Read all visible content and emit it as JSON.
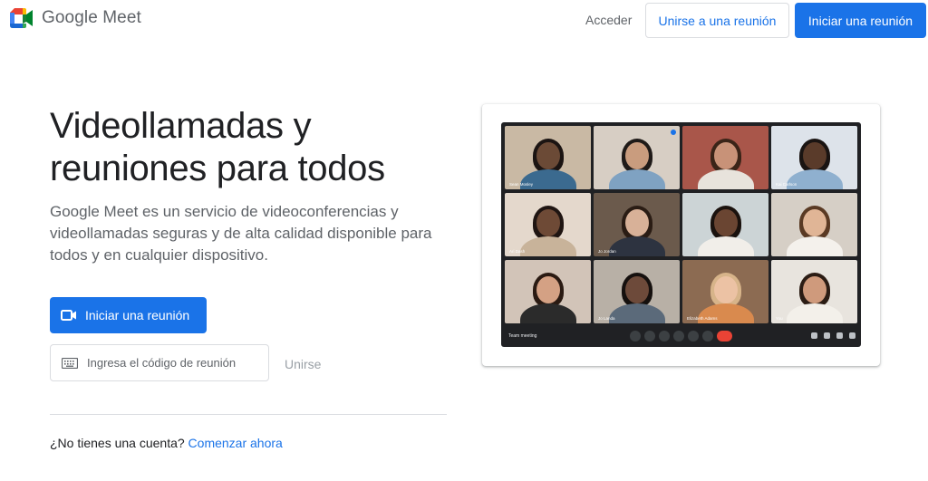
{
  "header": {
    "brand": "Google Meet",
    "sign_in": "Acceder",
    "join_meeting": "Unirse a una reunión",
    "start_meeting": "Iniciar una reunión"
  },
  "hero": {
    "title_line1": "Videollamadas y",
    "title_line2": "reuniones para todos",
    "subtitle": "Google Meet es un servicio de videoconferencias y videollamadas seguras y de alta calidad disponible para todos y en cualquier dispositivo.",
    "start_button": "Iniciar una reunión",
    "code_placeholder": "Ingresa el código de reunión",
    "join_link": "Unirse"
  },
  "footer": {
    "question": "¿No tienes una cuenta?",
    "cta": "Comenzar ahora"
  },
  "preview": {
    "meeting_name": "Team meeting",
    "tiles": [
      {
        "name": "Sean Mosley"
      },
      {
        "name": ""
      },
      {
        "name": ""
      },
      {
        "name": "Kai Carlson"
      },
      {
        "name": "Ari Dash"
      },
      {
        "name": "Jo Jordan"
      },
      {
        "name": ""
      },
      {
        "name": ""
      },
      {
        "name": ""
      },
      {
        "name": "Jo Landa"
      },
      {
        "name": "Elizabeth Adams"
      },
      {
        "name": "You"
      }
    ]
  },
  "colors": {
    "primary": "#1a73e8",
    "text": "#202124",
    "muted": "#5f6368",
    "border": "#dadce0",
    "end_call": "#ea4335"
  }
}
